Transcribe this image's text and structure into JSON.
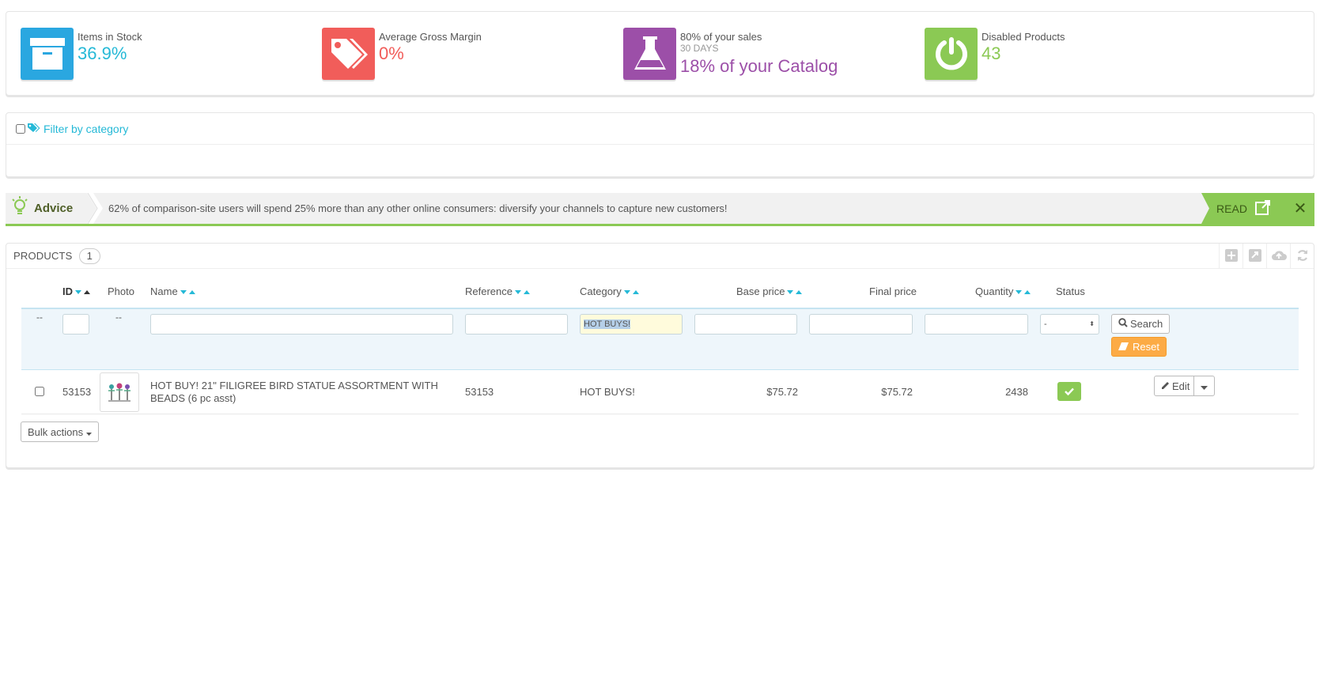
{
  "kpis": [
    {
      "icon": "archive-icon",
      "label": "Items in Stock",
      "value": "36.9%",
      "color": "#25b9d7",
      "icon_bg": "#2aa7e0"
    },
    {
      "icon": "tags-icon",
      "label": "Average Gross Margin",
      "value": "0%",
      "color": "#f15d5a",
      "icon_bg": "#f15d5a"
    },
    {
      "icon": "flask-icon",
      "label": "80% of your sales",
      "sub": "30 DAYS",
      "value": "18% of your Catalog",
      "color": "#9c4fa8",
      "icon_bg": "#9c4fa8"
    },
    {
      "icon": "power-icon",
      "label": "Disabled Products",
      "value": "43",
      "color": "#8bc954",
      "icon_bg": "#8bc954"
    }
  ],
  "filter": {
    "label": "Filter by category"
  },
  "advice": {
    "label": "Advice",
    "text": "62% of comparison-site users will spend 25% more than any other online consumers: diversify your channels to capture new customers!",
    "read_label": "READ"
  },
  "products": {
    "title": "PRODUCTS",
    "count": "1",
    "columns": {
      "id": "ID",
      "photo": "Photo",
      "name": "Name",
      "reference": "Reference",
      "category": "Category",
      "base_price": "Base price",
      "final_price": "Final price",
      "quantity": "Quantity",
      "status": "Status"
    },
    "filters": {
      "bulk_placeholder": "--",
      "photo_placeholder": "--",
      "category_value": "HOT BUYS!",
      "status_value": "-",
      "search_label": "Search",
      "reset_label": "Reset"
    },
    "rows": [
      {
        "id": "53153",
        "name": "HOT BUY! 21\" FILIGREE BIRD STATUE ASSORTMENT WITH BEADS (6 pc asst)",
        "reference": "53153",
        "category": "HOT BUYS!",
        "base_price": "$75.72",
        "final_price": "$75.72",
        "quantity": "2438",
        "edit_label": "Edit"
      }
    ],
    "bulk_actions_label": "Bulk actions"
  }
}
